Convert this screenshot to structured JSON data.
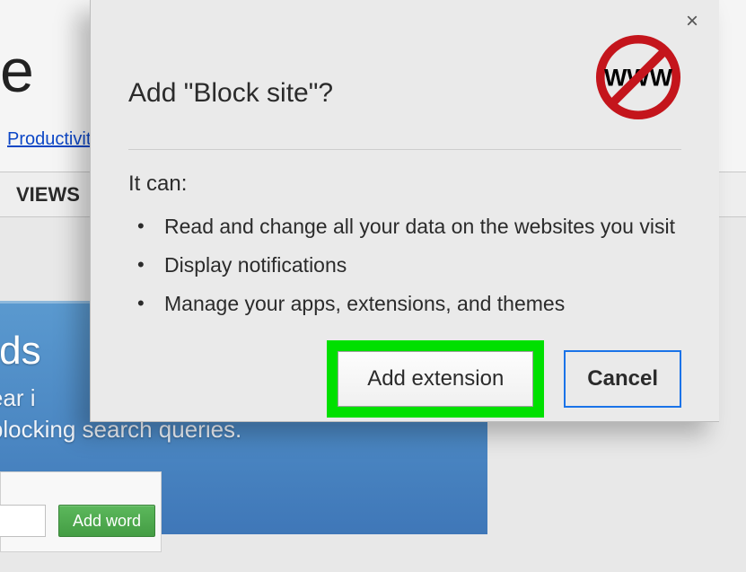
{
  "background": {
    "truncated_letter": "e",
    "productivity_link": "Productivity",
    "tab_views": "VIEWS",
    "blue_title": "ords",
    "blue_line1": "ppear i",
    "blue_line2": "th blocking search queries.",
    "add_word_button": "Add word"
  },
  "modal": {
    "title": "Add \"Block site\"?",
    "close_label": "×",
    "it_can": "It can:",
    "permissions": [
      "Read and change all your data on the websites you visit",
      "Display notifications",
      "Manage your apps, extensions, and themes"
    ],
    "add_button": "Add extension",
    "cancel_button": "Cancel",
    "icon_text": "WWW"
  }
}
